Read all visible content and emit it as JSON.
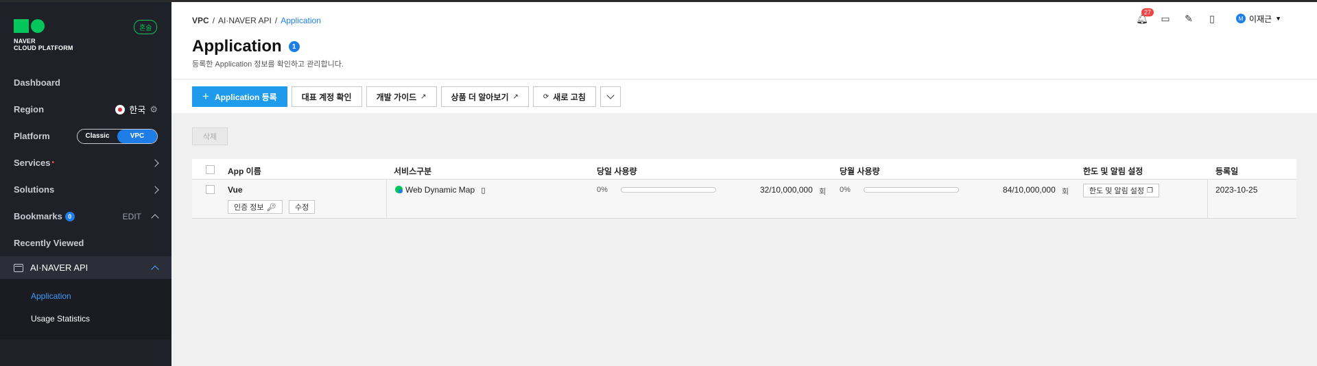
{
  "sidebar": {
    "logo_line1": "NAVER",
    "logo_line2": "CLOUD PLATFORM",
    "badge": "혼술",
    "items": {
      "dashboard": "Dashboard",
      "region": "Region",
      "region_value": "한국",
      "platform": "Platform",
      "platform_classic": "Classic",
      "platform_vpc": "VPC",
      "services": "Services",
      "services_dot": "•",
      "solutions": "Solutions",
      "bookmarks": "Bookmarks",
      "bookmarks_count": "0",
      "bookmarks_edit": "EDIT",
      "recently_viewed": "Recently Viewed"
    },
    "active_section": "AI·NAVER API",
    "sub_items": [
      "Application",
      "Usage Statistics"
    ]
  },
  "header": {
    "breadcrumbs": [
      "VPC",
      "/",
      "AI·NAVER API",
      "/",
      "Application"
    ],
    "title": "Application",
    "title_count": "1",
    "description": "등록한 Application 정보를 확인하고 관리합니다.",
    "notification_count": "27",
    "user_initial": "M",
    "user_name": "이재근"
  },
  "toolbar": {
    "register": "Application 등록",
    "check_account": "대표 계정 확인",
    "dev_guide": "개발 가이드",
    "learn_more": "상품 더 알아보기",
    "refresh": "새로 고침"
  },
  "delete_label": "삭제",
  "table": {
    "headers": [
      "App 이름",
      "서비스구분",
      "당일 사용량",
      "당월 사용량",
      "한도 및 알림 설정",
      "등록일"
    ],
    "rows": [
      {
        "app_name": "Vue",
        "auth_button": "인증 정보",
        "edit_button": "수정",
        "service": "Web Dynamic Map",
        "daily_percent": "0%",
        "daily_fraction": 3.2e-06,
        "daily_usage": "32/10,000,000",
        "daily_unit": "회",
        "monthly_percent": "0%",
        "monthly_fraction": 8.4e-06,
        "monthly_usage": "84/10,000,000",
        "monthly_unit": "회",
        "limit_button": "한도 및 알림 설정",
        "registered": "2023-10-25"
      }
    ]
  },
  "colors": {
    "sidebar_bg": "#1f2129",
    "accent_blue": "#1e7ee6",
    "primary_button": "#1e9bea",
    "brand_green": "#03c75a",
    "badge_red": "#f04545"
  }
}
